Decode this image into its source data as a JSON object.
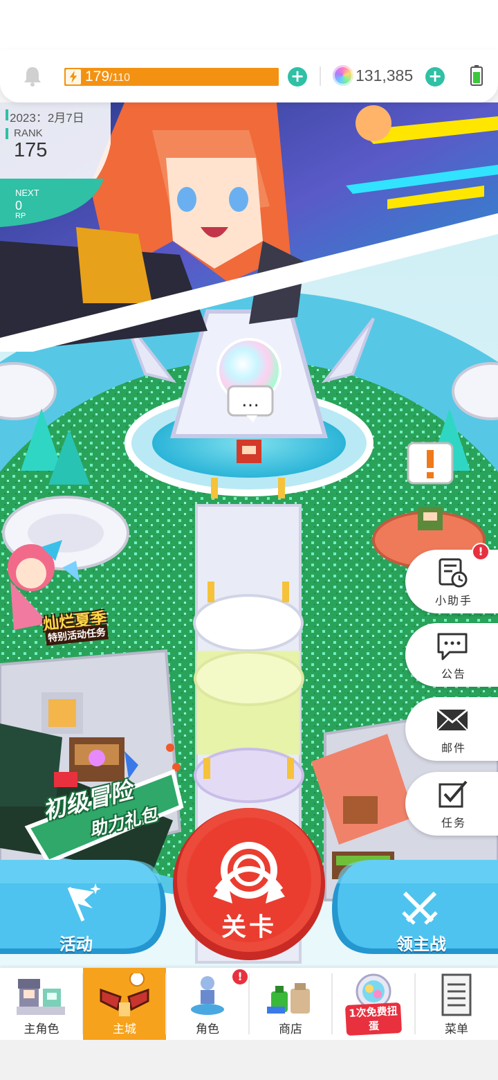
{
  "resources": {
    "stamina_current": "179",
    "stamina_max": "/110",
    "gems": "131,385"
  },
  "rank_panel": {
    "date": "2023：2月7日",
    "rank_label": "RANK",
    "rank_value": "175",
    "next_label": "NEXT",
    "next_value": "0",
    "next_unit": "RP"
  },
  "speech_bubble": "…",
  "side_menu": [
    {
      "label": "小助手",
      "icon": "assistant-clock-icon",
      "badge": "!"
    },
    {
      "label": "公告",
      "icon": "chat-bubble-icon"
    },
    {
      "label": "邮件",
      "icon": "mail-icon"
    },
    {
      "label": "任务",
      "icon": "checkbox-icon"
    }
  ],
  "promos": {
    "summer_title": "灿烂夏季",
    "summer_sub": "特别活动任务",
    "adventure_title": "初级冒险",
    "adventure_sub": "助力礼包"
  },
  "actions": {
    "event": "活动",
    "stage": "关卡",
    "lord_battle": "领主战"
  },
  "bottom_nav": [
    {
      "label": "主角色",
      "icon": "hero-characters-icon"
    },
    {
      "label": "主城",
      "icon": "main-city-icon",
      "active": true
    },
    {
      "label": "角色",
      "icon": "character-icon",
      "badge": "!"
    },
    {
      "label": "商店",
      "icon": "shop-icon"
    },
    {
      "label": "1次免费扭蛋",
      "icon": "gacha-icon"
    },
    {
      "label": "菜单",
      "icon": "menu-list-icon"
    }
  ],
  "gacha_text": "1次免费\n扭蛋",
  "colors": {
    "accent_teal": "#2fc0a5",
    "stamina_orange": "#f39212",
    "nav_active": "#f7a21c",
    "stage_red": "#e8352e",
    "action_blue": "#3bb3e8",
    "badge_red": "#e8303f"
  }
}
